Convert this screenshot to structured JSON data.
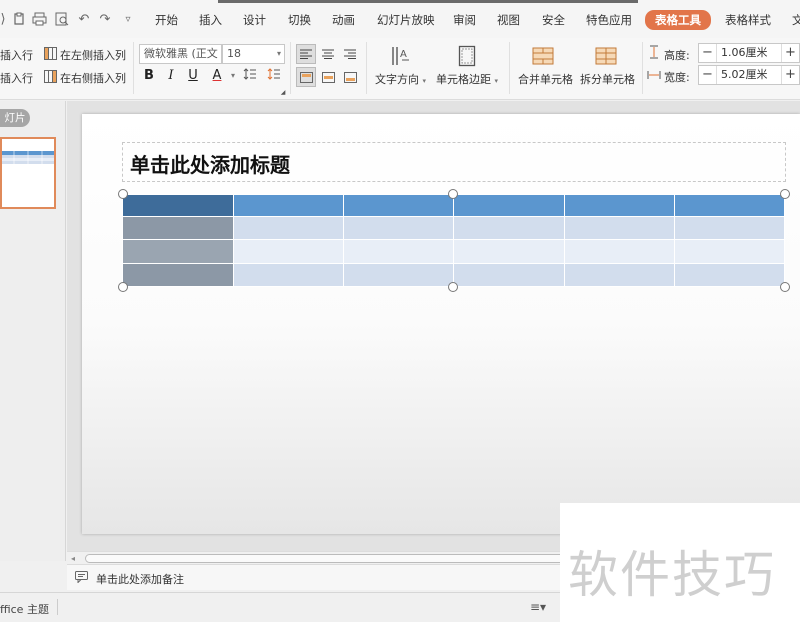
{
  "quick_access": {
    "icons": [
      "redo-partial-icon",
      "paste-icon",
      "print-icon",
      "print-preview-icon",
      "undo-icon",
      "redo-icon",
      "customize-dropdown-icon"
    ]
  },
  "menu": {
    "items": [
      "开始",
      "插入",
      "设计",
      "切换",
      "动画",
      "幻灯片放映",
      "审阅",
      "视图",
      "安全",
      "特色应用",
      "表格工具",
      "表格样式",
      "文"
    ],
    "active_index": 10,
    "active_color": "#e2754a"
  },
  "ribbon": {
    "insert_row_above": "插入行",
    "insert_row_below": "插入行",
    "insert_col_left": "在左侧插入列",
    "insert_col_right": "在右侧插入列",
    "font_name": "微软雅黑 (正文",
    "font_size": "18",
    "text_direction": "文字方向",
    "cell_margin": "单元格边距",
    "merge_cells": "合并单元格",
    "split_cells": "拆分单元格",
    "height_label": "高度:",
    "height_value": "1.06厘米",
    "width_label": "宽度:",
    "width_value": "5.02厘米"
  },
  "left_panel": {
    "tab_label": "灯片"
  },
  "slide": {
    "title_placeholder": "单击此处添加标题",
    "table": {
      "rows": 4,
      "cols": 6,
      "header_color": "#5b96cf",
      "first_col_color": "#8c98a6"
    }
  },
  "notes": {
    "placeholder": "单击此处添加备注"
  },
  "status": {
    "theme": "ffice 主题"
  },
  "watermark": {
    "text": "软件技巧"
  }
}
